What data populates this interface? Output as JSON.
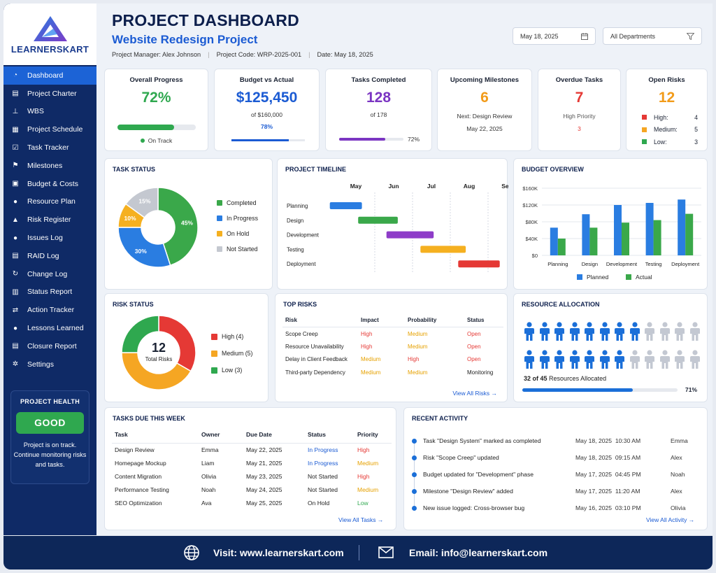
{
  "brand": {
    "name": "LEARNERSKART"
  },
  "sidebar": {
    "items": [
      {
        "label": "Dashboard",
        "icon": "dashboard-icon"
      },
      {
        "label": "Project Charter",
        "icon": "document-icon"
      },
      {
        "label": "WBS",
        "icon": "hierarchy-icon"
      },
      {
        "label": "Project Schedule",
        "icon": "calendar-icon"
      },
      {
        "label": "Task Tracker",
        "icon": "checklist-icon"
      },
      {
        "label": "Milestones",
        "icon": "flag-icon"
      },
      {
        "label": "Budget & Costs",
        "icon": "wallet-icon"
      },
      {
        "label": "Resource Plan",
        "icon": "users-icon"
      },
      {
        "label": "Risk Register",
        "icon": "warning-icon"
      },
      {
        "label": "Issues Log",
        "icon": "alert-icon"
      },
      {
        "label": "RAID Log",
        "icon": "clipboard-icon"
      },
      {
        "label": "Change Log",
        "icon": "refresh-icon"
      },
      {
        "label": "Status Report",
        "icon": "report-icon"
      },
      {
        "label": "Action Tracker",
        "icon": "exchange-icon"
      },
      {
        "label": "Lessons Learned",
        "icon": "bulb-icon"
      },
      {
        "label": "Closure Report",
        "icon": "closure-icon"
      },
      {
        "label": "Settings",
        "icon": "gear-icon"
      }
    ],
    "health": {
      "title": "PROJECT HEALTH",
      "status": "GOOD",
      "description": "Project is on track. Continue monitoring risks and tasks."
    }
  },
  "header": {
    "title": "PROJECT DASHBOARD",
    "subtitle": "Website Redesign Project",
    "manager": "Project Manager: Alex Johnson",
    "code": "Project Code: WRP-2025-001",
    "date": "Date: May 18, 2025",
    "date_picker": "May 18, 2025",
    "department": "All Departments"
  },
  "kpis": {
    "progress": {
      "title": "Overall Progress",
      "value": "72%",
      "fraction": 0.72,
      "status": "On Track"
    },
    "budget": {
      "title": "Budget vs Actual",
      "value": "$125,450",
      "sub": "of $160,000",
      "pct": "78%",
      "fraction": 0.78
    },
    "tasks": {
      "title": "Tasks Completed",
      "value": "128",
      "sub": "of 178",
      "pct": "72%",
      "fraction": 0.72
    },
    "milestones": {
      "title": "Upcoming Milestones",
      "value": "6",
      "next": "Next: Design Review",
      "date": "May 22, 2025"
    },
    "overdue": {
      "title": "Overdue Tasks",
      "value": "7",
      "label": "High Priority",
      "count": "3"
    },
    "risks": {
      "title": "Open Risks",
      "value": "12",
      "rows": [
        {
          "label": "High:",
          "value": "4",
          "color": "#e53935"
        },
        {
          "label": "Medium:",
          "value": "5",
          "color": "#f5a623"
        },
        {
          "label": "Low:",
          "value": "3",
          "color": "#2fa84f"
        }
      ]
    }
  },
  "task_status": {
    "title": "TASK STATUS",
    "legend": [
      {
        "label": "Completed",
        "color": "#3aa84a"
      },
      {
        "label": "In Progress",
        "color": "#2a7de1"
      },
      {
        "label": "On Hold",
        "color": "#f5b020"
      },
      {
        "label": "Not Started",
        "color": "#c4c8d0"
      }
    ]
  },
  "timeline": {
    "title": "PROJECT TIMELINE",
    "months": [
      "May",
      "Jun",
      "Jul",
      "Aug",
      "Sep"
    ],
    "tasks": [
      {
        "label": "Planning",
        "start": 0.05,
        "end": 0.9,
        "color": "#2a7de1"
      },
      {
        "label": "Design",
        "start": 0.8,
        "end": 1.85,
        "color": "#3aa84a"
      },
      {
        "label": "Development",
        "start": 1.55,
        "end": 2.8,
        "color": "#8e3cc8"
      },
      {
        "label": "Testing",
        "start": 2.45,
        "end": 3.65,
        "color": "#f5b020"
      },
      {
        "label": "Deployment",
        "start": 3.45,
        "end": 4.55,
        "color": "#e53935"
      }
    ]
  },
  "budget_overview": {
    "title": "BUDGET OVERVIEW",
    "legend": [
      {
        "label": "Planned",
        "color": "#2a7de1"
      },
      {
        "label": "Actual",
        "color": "#3aa84a"
      }
    ],
    "yticks": [
      "$160K",
      "$120K",
      "$80K",
      "$40K",
      "$0"
    ]
  },
  "risk_status": {
    "title": "RISK STATUS",
    "center_value": "12",
    "center_label": "Total Risks",
    "legend": [
      {
        "label": "High (4)",
        "color": "#e53935"
      },
      {
        "label": "Medium (5)",
        "color": "#f5a623"
      },
      {
        "label": "Low (3)",
        "color": "#2fa84f"
      }
    ]
  },
  "top_risks": {
    "title": "TOP RISKS",
    "headers": [
      "Risk",
      "Impact",
      "Probability",
      "Status"
    ],
    "rows": [
      [
        "Scope Creep",
        "High",
        "Medium",
        "Open"
      ],
      [
        "Resource Unavailability",
        "High",
        "Medium",
        "Open"
      ],
      [
        "Delay in Client Feedback",
        "Medium",
        "High",
        "Open"
      ],
      [
        "Third-party Dependency",
        "Medium",
        "Medium",
        "Monitoring"
      ]
    ],
    "link": "View All Risks →"
  },
  "resource": {
    "title": "RESOURCE ALLOCATION",
    "allocated": 32,
    "total": 45,
    "caption_bold": "32 of 45",
    "caption": "Resources Allocated",
    "pct": "71%",
    "fraction": 0.71
  },
  "tasks_due": {
    "title": "TASKS DUE THIS WEEK",
    "headers": [
      "Task",
      "Owner",
      "Due Date",
      "Status",
      "Priority"
    ],
    "rows": [
      [
        "Design Review",
        "Emma",
        "May 22, 2025",
        "In Progress",
        "High"
      ],
      [
        "Homepage Mockup",
        "Liam",
        "May 21, 2025",
        "In Progress",
        "Medium"
      ],
      [
        "Content Migration",
        "Olivia",
        "May 23, 2025",
        "Not Started",
        "High"
      ],
      [
        "Performance Testing",
        "Noah",
        "May 24, 2025",
        "Not Started",
        "Medium"
      ],
      [
        "SEO Optimization",
        "Ava",
        "May 25, 2025",
        "On Hold",
        "Low"
      ]
    ],
    "link": "View All Tasks →"
  },
  "activity": {
    "title": "RECENT ACTIVITY",
    "rows": [
      [
        "Task \"Design System\" marked as completed",
        "May 18, 2025  10:30 AM",
        "Emma"
      ],
      [
        "Risk \"Scope Creep\" updated",
        "May 18, 2025  09:15 AM",
        "Alex"
      ],
      [
        "Budget updated for \"Development\" phase",
        "May 17, 2025  04:45 PM",
        "Noah"
      ],
      [
        "Milestone \"Design Review\" added",
        "May 17, 2025  11:20 AM",
        "Alex"
      ],
      [
        "New issue logged: Cross-browser bug",
        "May 16, 2025  03:10 PM",
        "Olivia"
      ]
    ],
    "link": "View All Activity →"
  },
  "footer": {
    "visit": "Visit: www.learnerskart.com",
    "email": "Email: info@learnerskart.com"
  },
  "chart_data": [
    {
      "type": "pie",
      "title": "TASK STATUS",
      "labels": [
        "Completed",
        "In Progress",
        "On Hold",
        "Not Started"
      ],
      "values": [
        45,
        30,
        10,
        15
      ],
      "value_labels": [
        "45%",
        "30%",
        "10%",
        "15%"
      ],
      "colors": [
        "#3aa84a",
        "#2a7de1",
        "#f5b020",
        "#c4c8d0"
      ]
    },
    {
      "type": "bar",
      "title": "BUDGET OVERVIEW",
      "categories": [
        "Planning",
        "Design",
        "Development",
        "Testing",
        "Deployment"
      ],
      "series": [
        {
          "name": "Planned",
          "values": [
            66,
            98,
            120,
            125,
            133
          ]
        },
        {
          "name": "Actual",
          "values": [
            40,
            66,
            78,
            84,
            99
          ]
        }
      ],
      "ylim": [
        0,
        160
      ],
      "yticks": [
        0,
        40,
        80,
        120,
        160
      ],
      "grid": true,
      "legend": "bottom"
    },
    {
      "type": "pie",
      "title": "RISK STATUS",
      "labels": [
        "High (4)",
        "Medium (5)",
        "Low (3)"
      ],
      "values": [
        4,
        5,
        3
      ],
      "colors": [
        "#e53935",
        "#f5a623",
        "#2fa84f"
      ]
    }
  ]
}
